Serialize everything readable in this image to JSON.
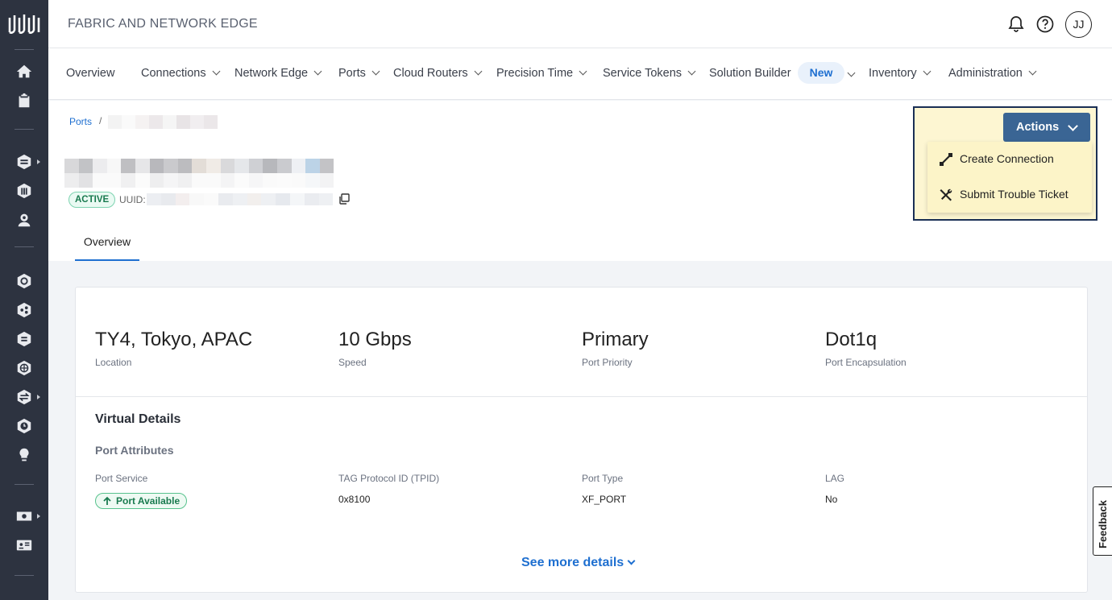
{
  "header": {
    "app_title": "FABRIC AND NETWORK EDGE",
    "user_initials": "JJ"
  },
  "nav": {
    "items": [
      {
        "label": "Overview"
      },
      {
        "label": "Connections"
      },
      {
        "label": "Network Edge"
      },
      {
        "label": "Ports"
      },
      {
        "label": "Cloud Routers"
      },
      {
        "label": "Precision Time"
      },
      {
        "label": "Service Tokens"
      },
      {
        "label": "Solution Builder"
      },
      {
        "label": "Inventory"
      },
      {
        "label": "Administration"
      }
    ],
    "new_badge": "New"
  },
  "breadcrumb": {
    "root": "Ports",
    "separator": "/"
  },
  "port": {
    "status": "ACTIVE",
    "uuid_label": "UUID:"
  },
  "tabs": [
    {
      "label": "Overview",
      "active": true
    }
  ],
  "actions": {
    "button_label": "Actions",
    "menu": [
      {
        "label": "Create Connection",
        "icon": "connection-icon"
      },
      {
        "label": "Submit Trouble Ticket",
        "icon": "tools-icon"
      }
    ]
  },
  "summary": [
    {
      "value": "TY4, Tokyo, APAC",
      "label": "Location"
    },
    {
      "value": "10 Gbps",
      "label": "Speed"
    },
    {
      "value": "Primary",
      "label": "Port Priority"
    },
    {
      "value": "Dot1q",
      "label": "Port Encapsulation"
    }
  ],
  "virtual_details": {
    "title": "Virtual Details",
    "subtitle": "Port Attributes",
    "attributes": [
      {
        "label": "Port Service",
        "value": "Port Available"
      },
      {
        "label": "TAG Protocol ID (TPID)",
        "value": "0x8100"
      },
      {
        "label": "Port Type",
        "value": "XF_PORT"
      },
      {
        "label": "LAG",
        "value": "No"
      }
    ],
    "see_more": "See more details"
  },
  "feedback_label": "Feedback",
  "colors": {
    "rail_bg": "#2d3340",
    "accent": "#1e6fd0",
    "actions_button": "#3a6594",
    "status_green": "#197a4f",
    "highlight": "#fdf6d2"
  }
}
